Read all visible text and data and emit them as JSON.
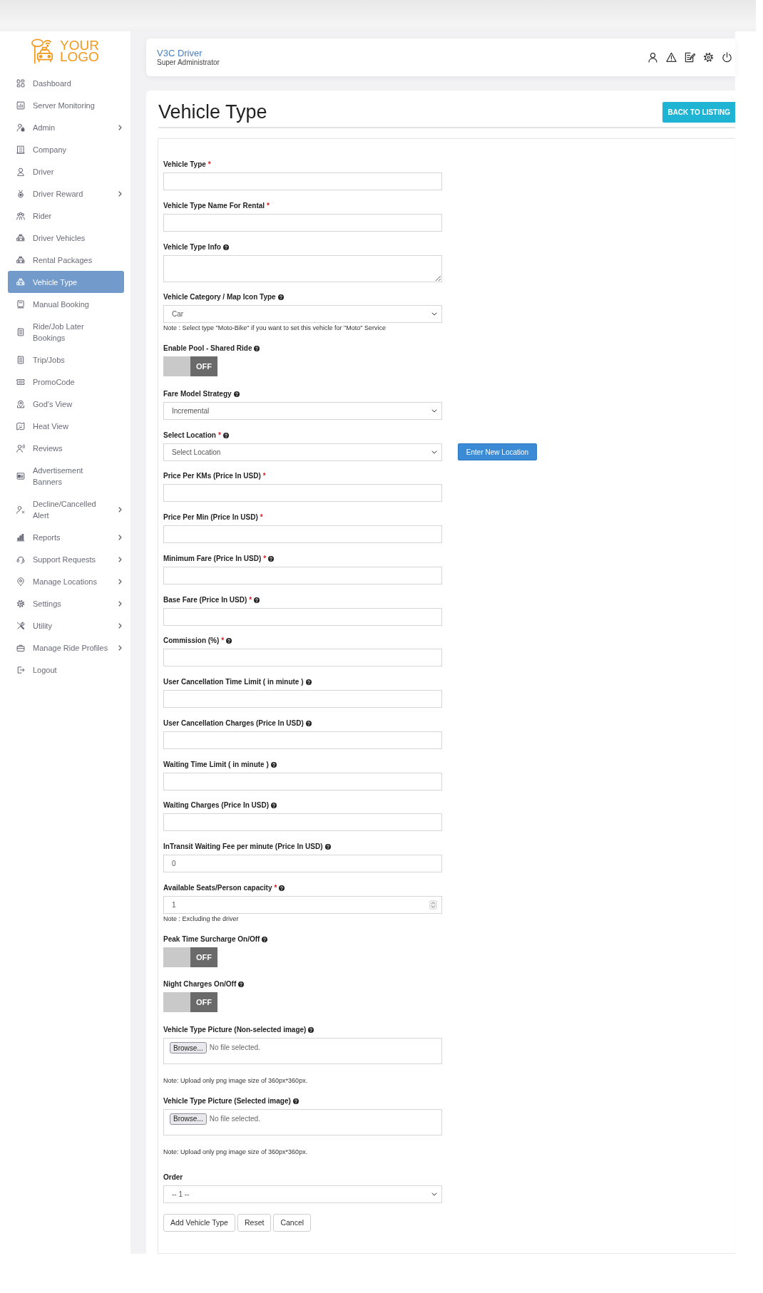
{
  "sidebar": {
    "logo_text": "YOUR LOGO",
    "items": [
      {
        "label": "Dashboard",
        "selected": false,
        "has_submenu": false
      },
      {
        "label": "Server Monitoring",
        "selected": false,
        "has_submenu": false
      },
      {
        "label": "Admin",
        "selected": false,
        "has_submenu": true
      },
      {
        "label": "Company",
        "selected": false,
        "has_submenu": false
      },
      {
        "label": "Driver",
        "selected": false,
        "has_submenu": false
      },
      {
        "label": "Driver Reward",
        "selected": false,
        "has_submenu": true
      },
      {
        "label": "Rider",
        "selected": false,
        "has_submenu": false
      },
      {
        "label": "Driver Vehicles",
        "selected": false,
        "has_submenu": false
      },
      {
        "label": "Rental Packages",
        "selected": false,
        "has_submenu": false
      },
      {
        "label": "Vehicle Type",
        "selected": true,
        "has_submenu": false
      },
      {
        "label": "Manual Booking",
        "selected": false,
        "has_submenu": false
      },
      {
        "label": "Ride/Job Later Bookings",
        "selected": false,
        "has_submenu": false
      },
      {
        "label": "Trip/Jobs",
        "selected": false,
        "has_submenu": false
      },
      {
        "label": "PromoCode",
        "selected": false,
        "has_submenu": false
      },
      {
        "label": "God's View",
        "selected": false,
        "has_submenu": false
      },
      {
        "label": "Heat View",
        "selected": false,
        "has_submenu": false
      },
      {
        "label": "Reviews",
        "selected": false,
        "has_submenu": false
      },
      {
        "label": "Advertisement Banners",
        "selected": false,
        "has_submenu": false
      },
      {
        "label": "Decline/Cancelled Alert",
        "selected": false,
        "has_submenu": true
      },
      {
        "label": "Reports",
        "selected": false,
        "has_submenu": true
      },
      {
        "label": "Support Requests",
        "selected": false,
        "has_submenu": true
      },
      {
        "label": "Manage Locations",
        "selected": false,
        "has_submenu": true
      },
      {
        "label": "Settings",
        "selected": false,
        "has_submenu": true
      },
      {
        "label": "Utility",
        "selected": false,
        "has_submenu": true
      },
      {
        "label": "Manage Ride Profiles",
        "selected": false,
        "has_submenu": true
      },
      {
        "label": "Logout",
        "selected": false,
        "has_submenu": false
      }
    ]
  },
  "header": {
    "title": "V3C Driver",
    "subtitle": "Super Administrator"
  },
  "page": {
    "title": "Vehicle Type",
    "back_button": "BACK TO LISTING"
  },
  "form": {
    "fields": [
      {
        "kind": "text",
        "label": "Vehicle Type",
        "required_mark": "*",
        "help": false
      },
      {
        "kind": "text",
        "label": "Vehicle Type Name For Rental",
        "required_mark": "*",
        "help": false
      },
      {
        "kind": "textarea",
        "label": "Vehicle Type Info",
        "help": true
      },
      {
        "kind": "select",
        "label": "Vehicle Category / Map Icon Type",
        "help": true,
        "value": "Car",
        "note": "Note : Select type \"Moto-Bike\" if you want to set this vehicle for \"Moto\" Service"
      },
      {
        "kind": "toggle",
        "label": "Enable Pool - Shared Ride",
        "help": true,
        "on": false,
        "state_text": "OFF"
      },
      {
        "kind": "select",
        "label": "Fare Model Strategy",
        "help": true,
        "value": "Incremental"
      },
      {
        "kind": "select",
        "label": "Select Location",
        "required_mark": "*",
        "help": true,
        "value": "Select Location",
        "button": "Enter New Location"
      },
      {
        "kind": "text",
        "label": "Price Per KMs (Price In USD)",
        "required_mark": "*",
        "help": false
      },
      {
        "kind": "text",
        "label": "Price Per Min (Price In USD)",
        "required_mark": "*",
        "help": false
      },
      {
        "kind": "text",
        "label": "Minimum Fare (Price In USD)",
        "required_mark": "*",
        "help": true
      },
      {
        "kind": "text",
        "label": "Base Fare (Price In USD)",
        "required_mark": "*",
        "help": true
      },
      {
        "kind": "text",
        "label": "Commission (%)",
        "required_mark": "*",
        "help": true
      },
      {
        "kind": "text",
        "label": "User Cancellation Time Limit ( in minute )",
        "help": true
      },
      {
        "kind": "text",
        "label": "User Cancellation Charges (Price In USD)",
        "help": true
      },
      {
        "kind": "text",
        "label": "Waiting Time Limit ( in minute )",
        "help": true
      },
      {
        "kind": "text",
        "label": "Waiting Charges (Price In USD)",
        "help": true
      },
      {
        "kind": "text",
        "label": "InTransit Waiting Fee per minute (Price In USD)",
        "help": true,
        "value": "0"
      },
      {
        "kind": "number",
        "label": "Available Seats/Person capacity",
        "required_mark": "*",
        "help": true,
        "value": "1",
        "note": "Note : Excluding the driver"
      },
      {
        "kind": "toggle",
        "label": "Peak Time Surcharge On/Off",
        "help": true,
        "on": false,
        "state_text": "OFF"
      },
      {
        "kind": "toggle",
        "label": "Night Charges On/Off",
        "help": true,
        "on": false,
        "state_text": "OFF"
      },
      {
        "kind": "file",
        "label": "Vehicle Type Picture (Non-selected image)",
        "help": true,
        "browse_label": "Browse...",
        "status_text": "No file selected.",
        "note": "Note: Upload only png image size of 360px*360px."
      },
      {
        "kind": "file",
        "label": "Vehicle Type Picture (Selected image)",
        "help": true,
        "browse_label": "Browse...",
        "status_text": "No file selected.",
        "note": "Note: Upload only png image size of 360px*360px."
      }
    ],
    "footer_fields": [
      {
        "kind": "select",
        "label": "Order",
        "help": false,
        "value": "-- 1 --"
      }
    ],
    "buttons": [
      "Add Vehicle Type",
      "Reset",
      "Cancel"
    ]
  }
}
